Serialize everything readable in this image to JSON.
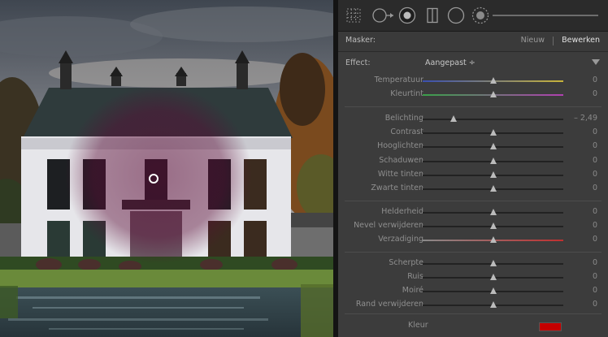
{
  "toolbar": {
    "tools": [
      {
        "name": "crop-grid-tool"
      },
      {
        "name": "spot-removal-tool"
      },
      {
        "name": "red-eye-tool"
      },
      {
        "name": "graduated-filter-tool"
      },
      {
        "name": "radial-filter-tool"
      },
      {
        "name": "adjustment-brush-tool"
      }
    ]
  },
  "mask": {
    "label": "Masker:",
    "new_label": "Nieuw",
    "edit_label": "Bewerken"
  },
  "effect": {
    "label": "Effect:",
    "value": "Aangepast ÷"
  },
  "sliders": [
    {
      "label": "Temperatuur",
      "value": "0",
      "pos": 0.5,
      "track": "temperature"
    },
    {
      "label": "Kleurtint",
      "value": "0",
      "pos": 0.5,
      "track": "tint"
    },
    {
      "label": "Belichting",
      "value": "– 2,49",
      "pos": 0.22,
      "track": "plain"
    },
    {
      "label": "Contrast",
      "value": "0",
      "pos": 0.5,
      "track": "plain"
    },
    {
      "label": "Hooglichten",
      "value": "0",
      "pos": 0.5,
      "track": "plain"
    },
    {
      "label": "Schaduwen",
      "value": "0",
      "pos": 0.5,
      "track": "plain"
    },
    {
      "label": "Witte tinten",
      "value": "0",
      "pos": 0.5,
      "track": "plain"
    },
    {
      "label": "Zwarte tinten",
      "value": "0",
      "pos": 0.5,
      "track": "plain"
    },
    {
      "label": "Helderheid",
      "value": "0",
      "pos": 0.5,
      "track": "plain"
    },
    {
      "label": "Nevel verwijderen",
      "value": "0",
      "pos": 0.5,
      "track": "plain"
    },
    {
      "label": "Verzadiging",
      "value": "0",
      "pos": 0.5,
      "track": "saturation"
    },
    {
      "label": "Scherpte",
      "value": "0",
      "pos": 0.5,
      "track": "plain"
    },
    {
      "label": "Ruis",
      "value": "0",
      "pos": 0.5,
      "track": "plain"
    },
    {
      "label": "Moiré",
      "value": "0",
      "pos": 0.5,
      "track": "plain"
    },
    {
      "label": "Rand verwijderen",
      "value": "0",
      "pos": 0.5,
      "track": "plain"
    }
  ],
  "color": {
    "label": "Kleur",
    "swatch": "#c40000"
  },
  "colors": {
    "panel_bg": "#3c3c3c",
    "mask_overlay": "#6a1040",
    "temperature_track": [
      "#3a4fb0",
      "#c8b43a"
    ],
    "tint_track": [
      "#3aa04a",
      "#b040b0"
    ],
    "saturation_track": [
      "#8a8a8a",
      "#c03030"
    ]
  }
}
